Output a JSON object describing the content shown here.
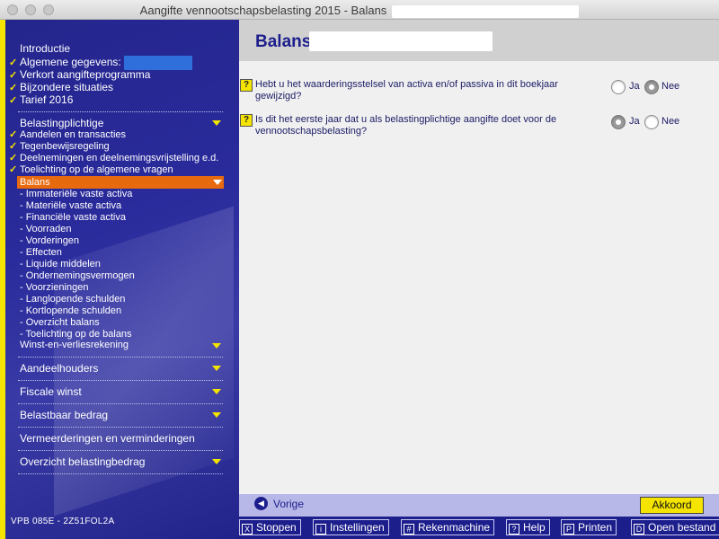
{
  "window": {
    "title": "Aangifte vennootschapsbelasting 2015 - Balans"
  },
  "sidebar": {
    "top_items": [
      {
        "label": "Introductie",
        "checked": false
      },
      {
        "label": "Algemene gegevens:",
        "checked": true
      },
      {
        "label": "Verkort aangifteprogramma",
        "checked": true
      },
      {
        "label": "Bijzondere situaties",
        "checked": true
      },
      {
        "label": "Tarief 2016",
        "checked": true
      }
    ],
    "section_belastingplichtige": "Belastingplichtige",
    "belastingplichtige_items": [
      {
        "label": "Aandelen en transacties",
        "checked": true
      },
      {
        "label": "Tegenbewijsregeling",
        "checked": true
      },
      {
        "label": "Deelnemingen en deelnemingsvrijstelling e.d.",
        "checked": true
      },
      {
        "label": "Toelichting op de algemene vragen",
        "checked": true
      }
    ],
    "active_item": "Balans",
    "balans_subitems": [
      "- Immateriële vaste activa",
      "- Materiële vaste activa",
      "- Financiële vaste activa",
      "- Voorraden",
      "- Vorderingen",
      "- Effecten",
      "- Liquide middelen",
      "- Ondernemingsvermogen",
      "- Voorzieningen",
      "- Langlopende schulden",
      "- Kortlopende schulden",
      "- Overzicht balans",
      "- Toelichting op de balans"
    ],
    "winst_item": "Winst-en-verliesrekening",
    "sections": [
      "Aandeelhouders",
      "Fiscale winst",
      "Belastbaar bedrag",
      "Vermeerderingen en verminderingen",
      "Overzicht belastingbedrag"
    ],
    "footer_code": "VPB 085E - 2Z51FOL2A"
  },
  "main": {
    "page_title": "Balans",
    "questions": [
      {
        "help": "?",
        "line1": "Hebt u het waarderingsstelsel van activa en/of passiva in dit boekjaar",
        "line2": "gewijzigd?",
        "options": [
          "Ja",
          "Nee"
        ],
        "selected": "Nee"
      },
      {
        "help": "?",
        "line1": "Is dit het eerste jaar dat u als belastingplichtige aangifte doet voor de",
        "line2": "vennootschapsbelasting?",
        "options": [
          "Ja",
          "Nee"
        ],
        "selected": "Ja"
      }
    ]
  },
  "navbar": {
    "back_label": "Vorige",
    "ok_label": "Akkoord"
  },
  "toolbar": {
    "buttons": [
      {
        "icon": "X",
        "label": "Stoppen"
      },
      {
        "icon": "i",
        "label": "Instellingen"
      },
      {
        "icon": "#",
        "label": "Rekenmachine"
      },
      {
        "icon": "?",
        "label": "Help"
      },
      {
        "icon": "P",
        "label": "Printen"
      },
      {
        "icon": "D",
        "label": "Open bestand"
      }
    ]
  },
  "colors": {
    "sidebar_blue": "#24258c",
    "accent_yellow": "#f5e400",
    "active_orange": "#e86a0e",
    "title_blue": "#1c1e8c"
  }
}
